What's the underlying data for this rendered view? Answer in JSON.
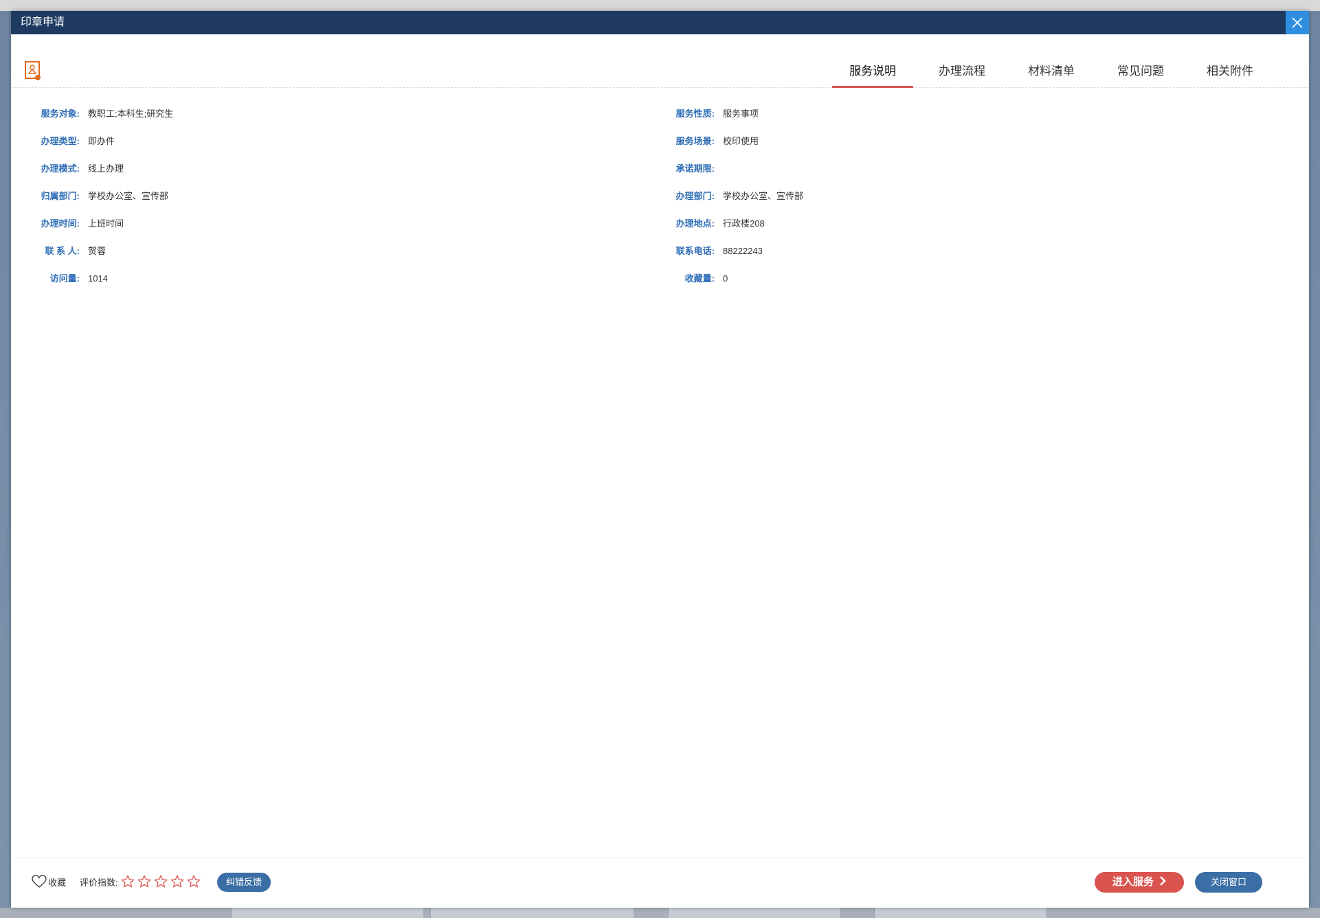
{
  "dialog": {
    "title": "印章申请"
  },
  "tabs": [
    {
      "label": "服务说明",
      "active": true
    },
    {
      "label": "办理流程",
      "active": false
    },
    {
      "label": "材料清单",
      "active": false
    },
    {
      "label": "常见问题",
      "active": false
    },
    {
      "label": "相关附件",
      "active": false
    }
  ],
  "info": {
    "left": [
      {
        "label": "服务对象:",
        "value": "教职工;本科生;研究生"
      },
      {
        "label": "办理类型:",
        "value": "即办件"
      },
      {
        "label": "办理模式:",
        "value": "线上办理"
      },
      {
        "label": "归属部门:",
        "value": "学校办公室、宣传部"
      },
      {
        "label": "办理时间:",
        "value": "上班时间"
      },
      {
        "label": "联 系 人:",
        "value": "贺蓉"
      },
      {
        "label": "访问量:",
        "value": "1014"
      }
    ],
    "right": [
      {
        "label": "服务性质:",
        "value": "服务事项"
      },
      {
        "label": "服务场景:",
        "value": "校印使用"
      },
      {
        "label": "承诺期限:",
        "value": ""
      },
      {
        "label": "办理部门:",
        "value": "学校办公室、宣传部"
      },
      {
        "label": "办理地点:",
        "value": "行政楼208"
      },
      {
        "label": "联系电话:",
        "value": "88222243"
      },
      {
        "label": "收藏量:",
        "value": "0"
      }
    ]
  },
  "footer": {
    "favorite_label": "收藏",
    "rating_label": "评价指数:",
    "rating_value": 0,
    "rating_max": 5,
    "feedback_label": "纠错反馈",
    "enter_label": "进入服务",
    "close_label": "关闭窗口"
  },
  "colors": {
    "titlebar": "#1e3a60",
    "close_button": "#2e8fe0",
    "accent_red": "#d9534f",
    "accent_blue": "#3b6ea5",
    "label_blue": "#2f6db5"
  }
}
